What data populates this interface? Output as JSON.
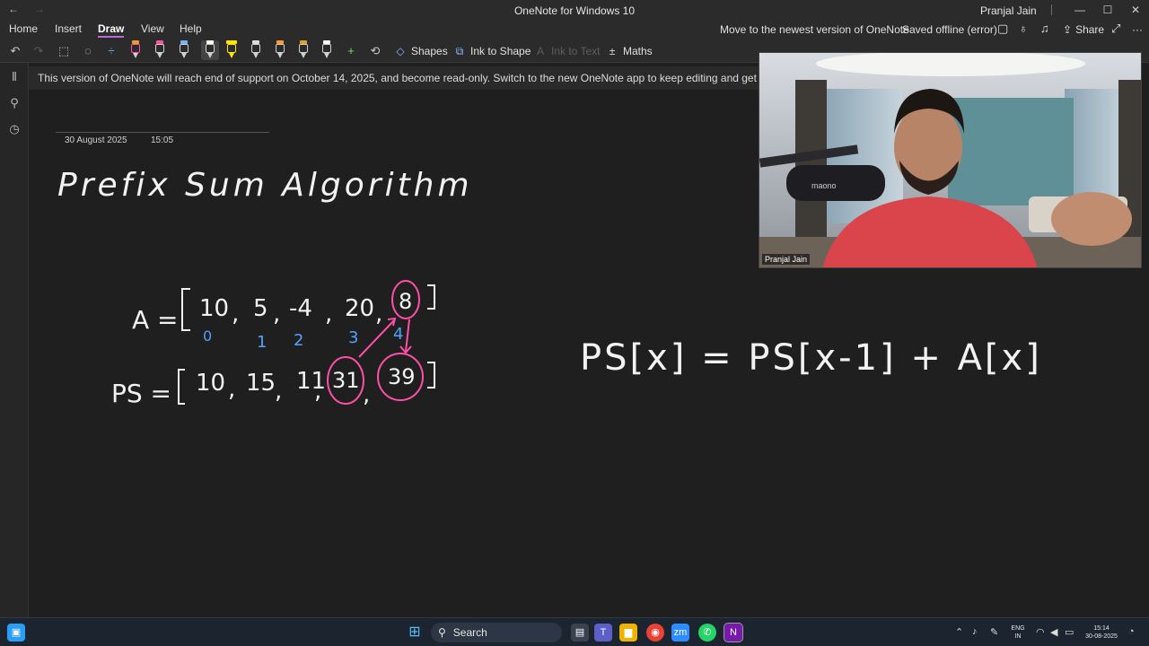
{
  "window": {
    "title": "OneNote for Windows 10",
    "user": "Pranjal Jain",
    "nav_back": "←",
    "nav_forward": "→",
    "minimize": "—",
    "maximize": "☐",
    "close": "✕"
  },
  "menu": {
    "tabs": [
      "Home",
      "Insert",
      "Draw",
      "View",
      "Help"
    ],
    "active_tab": "Draw",
    "upgrade_link": "Move to the newest version of OneNote",
    "sync_status": "Saved offline (error)",
    "share_label": "Share",
    "more": "···"
  },
  "toolbar": {
    "shapes_label": "Shapes",
    "ink_to_shape_label": "Ink to Shape",
    "ink_to_text_label": "Ink to Text",
    "maths_label": "Maths",
    "pens": [
      {
        "name": "pen-black",
        "color": "#e8a020"
      },
      {
        "name": "pen-pink",
        "color": "#ff4fa8"
      },
      {
        "name": "pen-blue",
        "color": "#6fb3ff"
      },
      {
        "name": "pen-white",
        "color": "#ffffff"
      },
      {
        "name": "highlighter-yellow",
        "color": "#ffe600"
      },
      {
        "name": "pen-gray",
        "color": "#dddddd"
      },
      {
        "name": "pen-orange",
        "color": "#ff9a2e"
      },
      {
        "name": "pen-amber",
        "color": "#e8a020"
      },
      {
        "name": "pen-white-2",
        "color": "#ffffff"
      }
    ]
  },
  "banner": {
    "text": "This version of OneNote will reach end of support on October 14, 2025, and become read-only. Switch to the new OneNote app to keep editing and get the late"
  },
  "page": {
    "date": "30 August 2025",
    "time": "15:05",
    "heading": "Prefix Sum Algorithm",
    "array_label": "A =",
    "array_values": [
      "10",
      "5",
      "-4",
      "20",
      "8"
    ],
    "indices": [
      "0",
      "1",
      "2",
      "3",
      "4"
    ],
    "ps_label": "PS =",
    "ps_values": [
      "10",
      "15",
      "11",
      "31",
      "39"
    ],
    "formula": "PS[x] = PS[x-1] + A[x]"
  },
  "video": {
    "participant": "Pranjal Jain",
    "mic_brand": "maono"
  },
  "taskbar": {
    "search_label": "Search",
    "lang_top": "ENG",
    "lang_bottom": "IN",
    "clock_time": "15:14",
    "clock_date": "30-08-2025"
  },
  "colors": {
    "ink_white": "#f2f2f2",
    "ink_pink": "#ff4fa8",
    "ink_blue": "#4fa3ff",
    "accent": "#b96ad9"
  }
}
